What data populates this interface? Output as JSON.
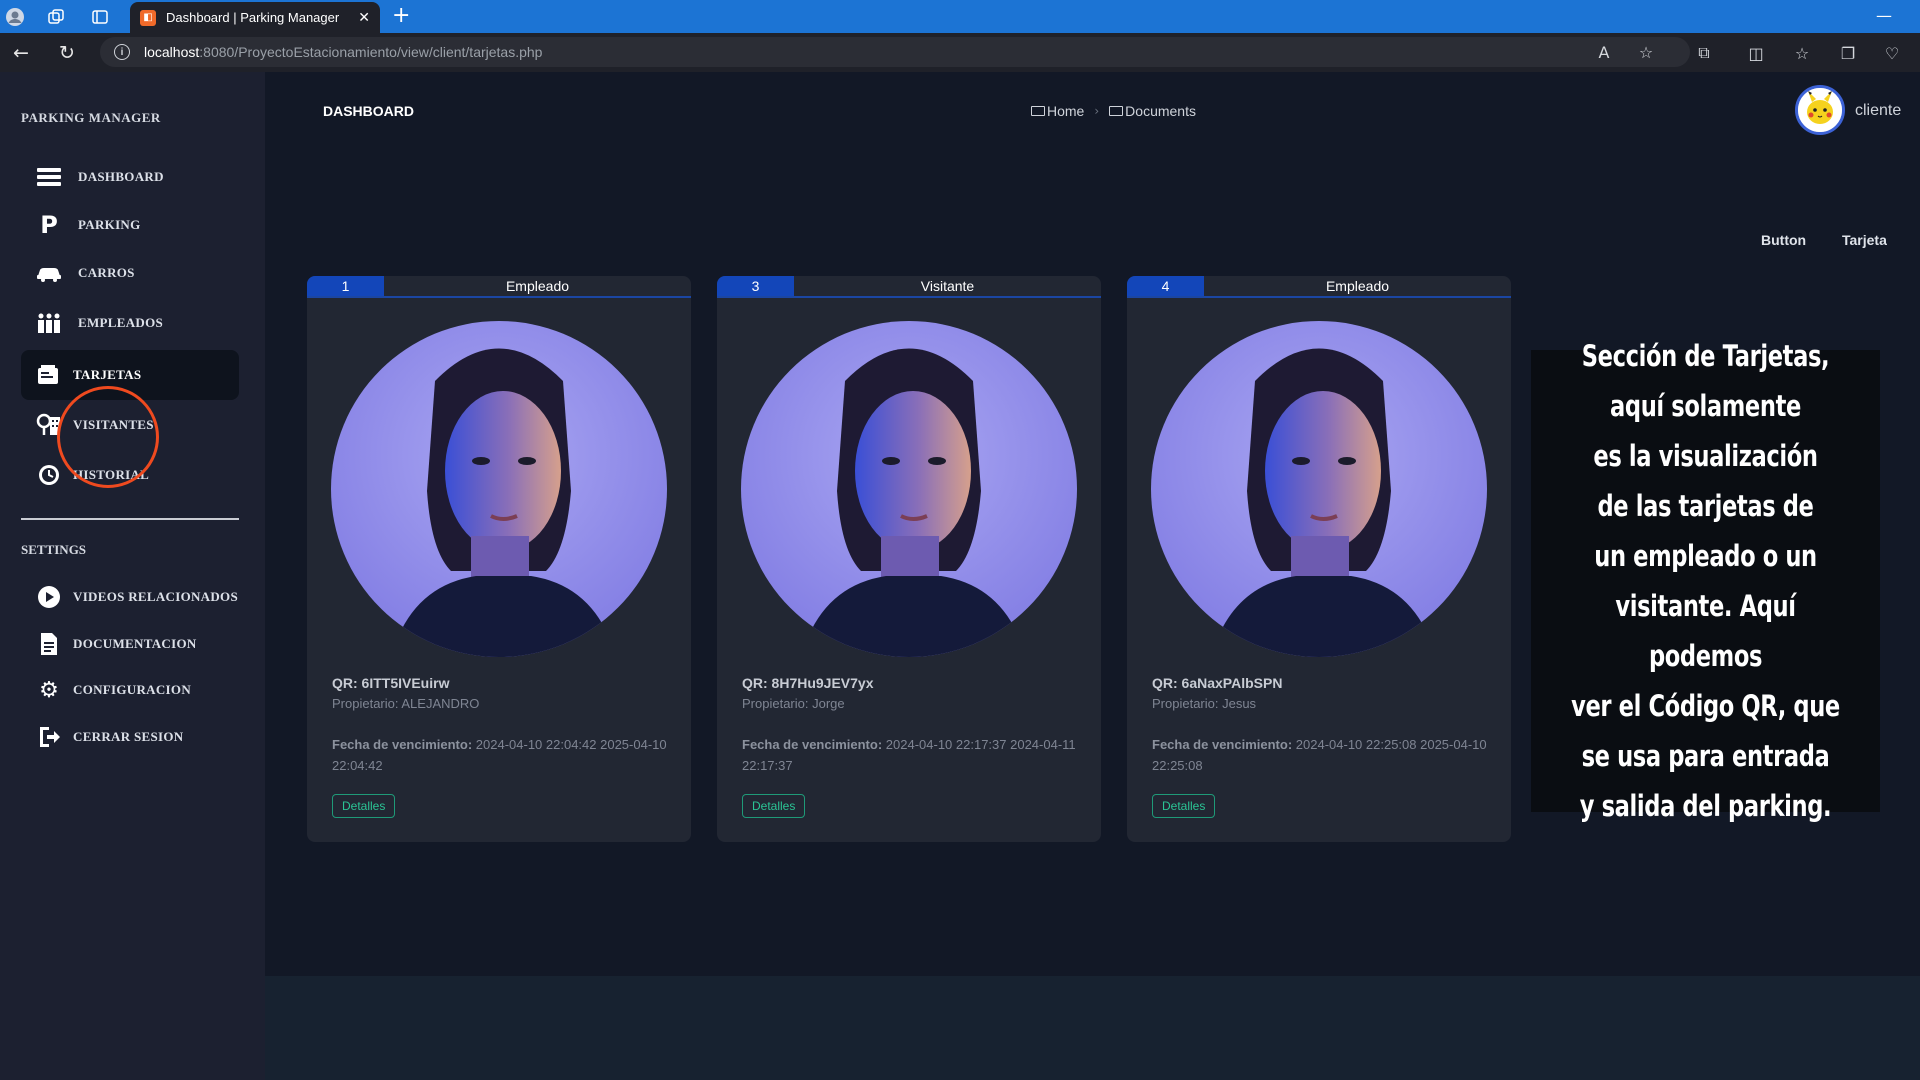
{
  "browser": {
    "tab_title": "Dashboard | Parking Manager",
    "url_host": "localhost",
    "url_rest": ":8080/ProyectoEstacionamiento/view/client/tarjetas.php"
  },
  "sidebar": {
    "brand": "PARKING MANAGER",
    "items": [
      {
        "label": "DASHBOARD",
        "icon": "menu-icon"
      },
      {
        "label": "PARKING",
        "icon": "parking-icon"
      },
      {
        "label": "CARROS",
        "icon": "car-icon"
      },
      {
        "label": "EMPLEADOS",
        "icon": "people-icon"
      },
      {
        "label": "TARJETAS",
        "icon": "card-icon"
      },
      {
        "label": "VISITANTES",
        "icon": "visitor-icon"
      },
      {
        "label": "HISTORIAL",
        "icon": "history-icon"
      }
    ],
    "settings_title": "SETTINGS",
    "settings_items": [
      {
        "label": "VIDEOS RELACIONADOS",
        "icon": "play-icon"
      },
      {
        "label": "DOCUMENTACION",
        "icon": "document-icon"
      },
      {
        "label": "CONFIGURACION",
        "icon": "gear-icon"
      },
      {
        "label": "CERRAR SESION",
        "icon": "logout-icon"
      }
    ],
    "active": "TARJETAS"
  },
  "header": {
    "title": "DASHBOARD",
    "breadcrumb": [
      "Home",
      "Documents"
    ],
    "user": "cliente"
  },
  "actions": {
    "button_label": "Button",
    "tarjeta_label": "Tarjeta"
  },
  "cards": [
    {
      "id": "1",
      "type": "Empleado",
      "qr": "QR: 6ITT5IVEuirw",
      "owner": "Propietario: ALEJANDRO",
      "date_label": "Fecha de vencimiento:",
      "dates": "2024-04-10 22:04:42 2025-04-10 22:04:42",
      "details": "Detalles"
    },
    {
      "id": "3",
      "type": "Visitante",
      "qr": "QR: 8H7Hu9JEV7yx",
      "owner": "Propietario: Jorge",
      "date_label": "Fecha de vencimiento:",
      "dates": "2024-04-10 22:17:37 2024-04-11 22:17:37",
      "details": "Detalles"
    },
    {
      "id": "4",
      "type": "Empleado",
      "qr": "QR: 6aNaxPAlbSPN",
      "owner": "Propietario: Jesus",
      "date_label": "Fecha de vencimiento:",
      "dates": "2024-04-10 22:25:08 2025-04-10 22:25:08",
      "details": "Detalles"
    }
  ],
  "overlay_note": "Sección de Tarjetas,\naquí solamente\nes la visualización\nde las tarjetas de\nun empleado o un\nvisitante. Aquí podemos\nver el Código QR, que\nse usa para entrada\ny salida del parking.",
  "colors": {
    "accent_blue": "#1346b9",
    "details_green": "#2bc495",
    "highlight_circle": "#ef4a1f"
  }
}
